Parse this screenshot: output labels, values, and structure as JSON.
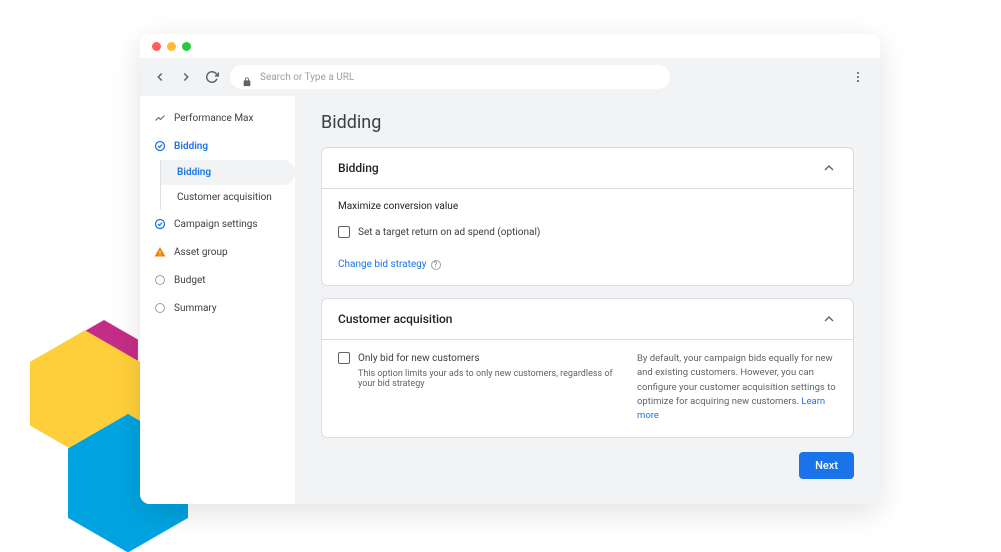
{
  "browser": {
    "url_placeholder": "Search or Type a URL"
  },
  "sidebar": {
    "items": [
      {
        "label": "Performance Max",
        "icon": "trend"
      },
      {
        "label": "Bidding",
        "icon": "check-circle",
        "active": true
      },
      {
        "label": "Campaign settings",
        "icon": "check-circle"
      },
      {
        "label": "Asset group",
        "icon": "warning"
      },
      {
        "label": "Budget",
        "icon": "circle"
      },
      {
        "label": "Summary",
        "icon": "circle"
      }
    ],
    "sub": {
      "bidding": "Bidding",
      "customer_acq": "Customer acquisition"
    }
  },
  "page": {
    "title": "Bidding"
  },
  "bidding_card": {
    "title": "Bidding",
    "strategy": "Maximize conversion value",
    "checkbox_label": "Set a target return on ad spend (optional)",
    "change_link": "Change bid strategy"
  },
  "ca_card": {
    "title": "Customer acquisition",
    "checkbox_label": "Only bid for new customers",
    "hint": "This option limits your ads to only new customers, regardless of your bid strategy",
    "info": "By default, your campaign bids equally for new and existing customers. However, you can configure your customer acquisition settings to optimize for acquiring new customers. ",
    "learn_more": "Learn more"
  },
  "footer": {
    "next": "Next"
  }
}
